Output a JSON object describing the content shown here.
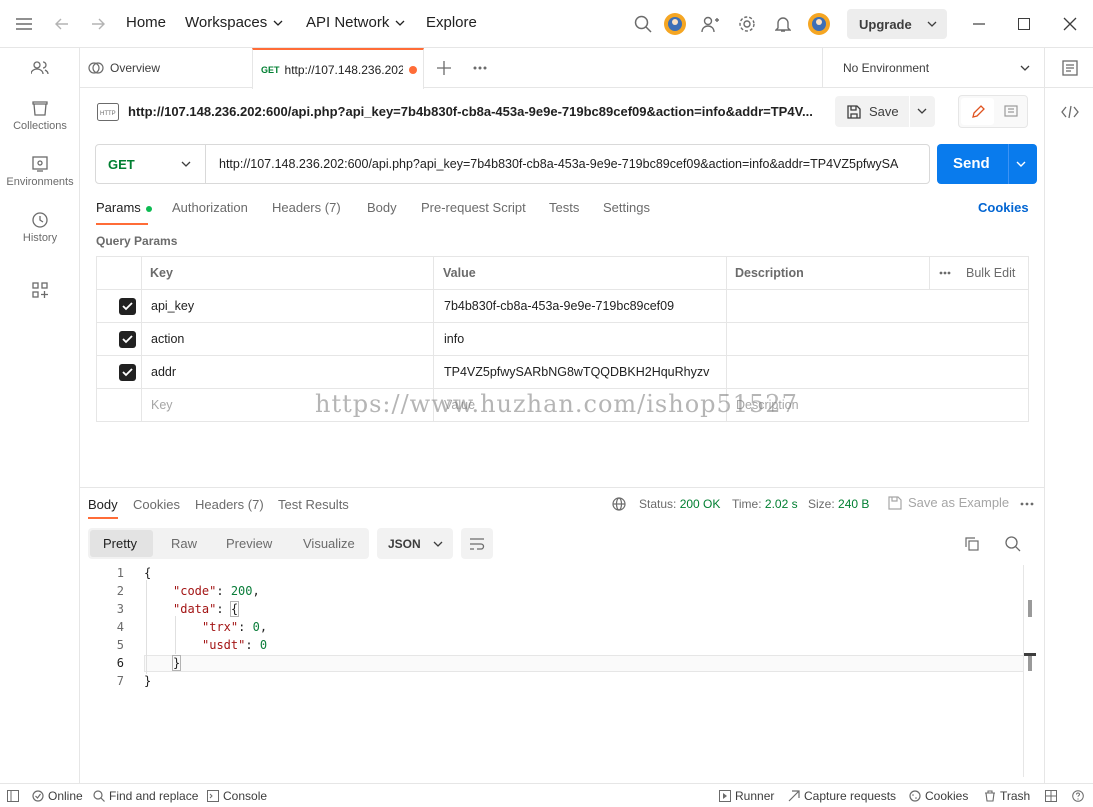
{
  "header": {
    "nav": [
      "Home",
      "Workspaces",
      "API Network",
      "Explore"
    ],
    "upgrade": "Upgrade"
  },
  "sidebar": {
    "items": [
      {
        "label": "Collections",
        "icon": "collections-icon"
      },
      {
        "label": "Environments",
        "icon": "environments-icon"
      },
      {
        "label": "History",
        "icon": "history-icon"
      }
    ]
  },
  "tabs": {
    "overview": "Overview",
    "active_method": "GET",
    "active_title": "http://107.148.236.202",
    "environment": "No Environment"
  },
  "request": {
    "title": "http://107.148.236.202:600/api.php?api_key=7b4b830f-cb8a-453a-9e9e-719bc89cef09&action=info&addr=TP4V...",
    "save": "Save",
    "method": "GET",
    "url": "http://107.148.236.202:600/api.php?api_key=7b4b830f-cb8a-453a-9e9e-719bc89cef09&action=info&addr=TP4VZ5pfwySA",
    "send": "Send",
    "tabs": {
      "params": "Params",
      "authorization": "Authorization",
      "headers": "Headers",
      "headers_count": "(7)",
      "body": "Body",
      "prerequest": "Pre-request Script",
      "tests": "Tests",
      "settings": "Settings",
      "cookies": "Cookies"
    },
    "query_title": "Query Params",
    "columns": {
      "key": "Key",
      "value": "Value",
      "description": "Description",
      "bulk": "Bulk Edit"
    },
    "params": [
      {
        "key": "api_key",
        "value": "7b4b830f-cb8a-453a-9e9e-719bc89cef09"
      },
      {
        "key": "action",
        "value": "info"
      },
      {
        "key": "addr",
        "value": "TP4VZ5pfwySARbNG8wTQQDBKH2HquRhyzv"
      }
    ],
    "placeholders": {
      "key": "Key",
      "value": "Value",
      "description": "Description"
    }
  },
  "watermark": "https://www.huzhan.com/ishop51527",
  "response": {
    "tabs": {
      "body": "Body",
      "cookies": "Cookies",
      "headers": "Headers",
      "headers_count": "(7)",
      "tests": "Test Results"
    },
    "status_label": "Status:",
    "status_value": "200 OK",
    "time_label": "Time:",
    "time_value": "2.02 s",
    "size_label": "Size:",
    "size_value": "240 B",
    "save_example": "Save as Example",
    "views": [
      "Pretty",
      "Raw",
      "Preview",
      "Visualize"
    ],
    "format": "JSON",
    "line_numbers": [
      "1",
      "2",
      "3",
      "4",
      "5",
      "6",
      "7"
    ],
    "code": {
      "open": "{",
      "code_key": "\"code\"",
      "code_val": "200",
      "data_key": "\"data\"",
      "data_open": "{",
      "trx_key": "\"trx\"",
      "trx_val": "0",
      "usdt_key": "\"usdt\"",
      "usdt_val": "0",
      "data_close": "}",
      "close": "}"
    }
  },
  "statusbar": {
    "online": "Online",
    "find": "Find and replace",
    "console": "Console",
    "runner": "Runner",
    "capture": "Capture requests",
    "cookies": "Cookies",
    "trash": "Trash"
  },
  "colors": {
    "accent": "#097bed",
    "get": "#007f31",
    "orange": "#ff6c37",
    "string": "#a31515",
    "number": "#0a7d3a"
  }
}
